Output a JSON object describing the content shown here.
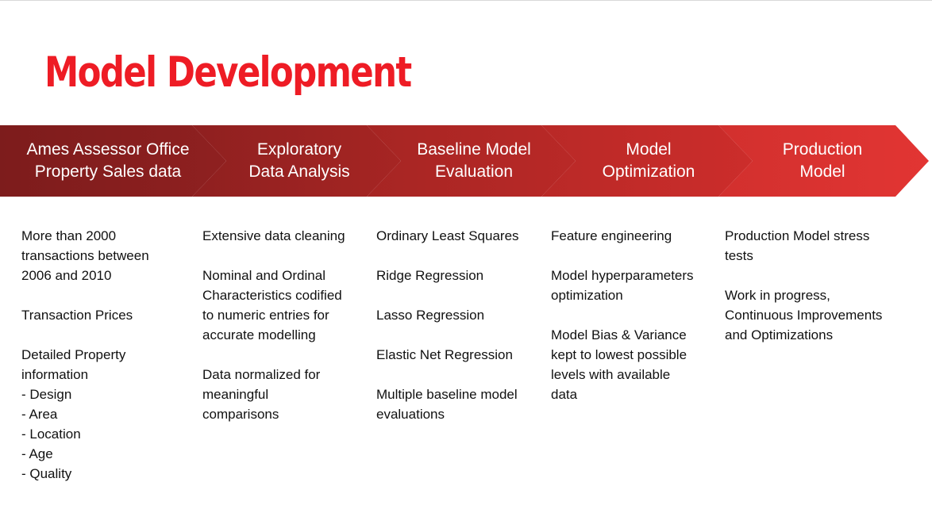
{
  "slide": {
    "title": "Model Development",
    "accent_color": "#ee1c25",
    "stages": [
      {
        "label": "Ames Assessor Office\nProperty Sales data",
        "color": "#8b1f1f",
        "details": "More than 2000\ntransactions between\n2006 and 2010\n\nTransaction Prices\n\nDetailed Property\ninformation\n- Design\n- Area\n- Location\n- Age\n- Quality"
      },
      {
        "label": "Exploratory\nData Analysis",
        "color": "#a02422",
        "details": "Extensive data cleaning\n\nNominal and Ordinal\nCharacteristics codified\nto numeric entries for\naccurate modelling\n\nData normalized for\nmeaningful\ncomparisons"
      },
      {
        "label": "Baseline Model\nEvaluation",
        "color": "#b32826",
        "details": "Ordinary Least Squares\n\nRidge Regression\n\nLasso Regression\n\nElastic Net Regression\n\nMultiple baseline model\nevaluations"
      },
      {
        "label": "Model\nOptimization",
        "color": "#c72c2a",
        "details": "Feature engineering\n\nModel hyperparameters\noptimization\n\nModel Bias & Variance\nkept to lowest possible\nlevels with available\ndata"
      },
      {
        "label": "Production\nModel",
        "color": "#dd3331",
        "details": "Production Model stress\ntests\n\nWork in progress,\nContinuous Improvements\nand Optimizations"
      }
    ]
  }
}
